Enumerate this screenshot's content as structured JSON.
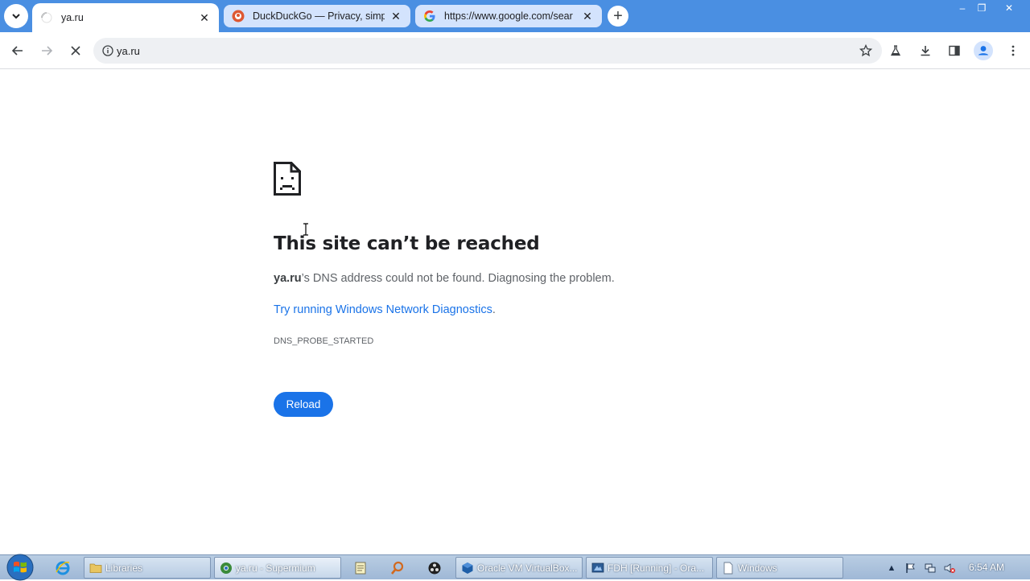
{
  "browser": {
    "tabs": [
      {
        "title": "ya.ru",
        "favicon": "loading-spinner-icon",
        "active": true
      },
      {
        "title": "DuckDuckGo — Privacy, simpl",
        "favicon": "duckduckgo-icon",
        "active": false
      },
      {
        "title": "https://www.google.com/sear",
        "favicon": "google-icon",
        "active": false
      }
    ],
    "window_controls": {
      "minimize": "–",
      "restore": "❐",
      "close": "✕"
    },
    "new_tab_label": "+",
    "address": "ya.ru"
  },
  "error_page": {
    "title": "This site can’t be reached",
    "host": "ya.ru",
    "description_rest": "’s DNS address could not be found. Diagnosing the problem.",
    "link_text": "Try running Windows Network Diagnostics",
    "link_suffix": ".",
    "error_code": "DNS_PROBE_STARTED",
    "reload_label": "Reload"
  },
  "taskbar": {
    "items": [
      {
        "label": "Libraries",
        "icon": "folder-icon"
      },
      {
        "label": "ya.ru - Supermium",
        "icon": "supermium-icon"
      },
      {
        "label": "Oracle VM VirtualBox...",
        "icon": "virtualbox-icon"
      },
      {
        "label": "FDH [Running] - Ora...",
        "icon": "vm-running-icon"
      },
      {
        "label": "Windows",
        "icon": "document-icon"
      }
    ],
    "clock": "6:54 AM"
  },
  "colors": {
    "tabstrip": "#4a8fe2",
    "link": "#1a73e8",
    "reload_button": "#1a73e8"
  }
}
